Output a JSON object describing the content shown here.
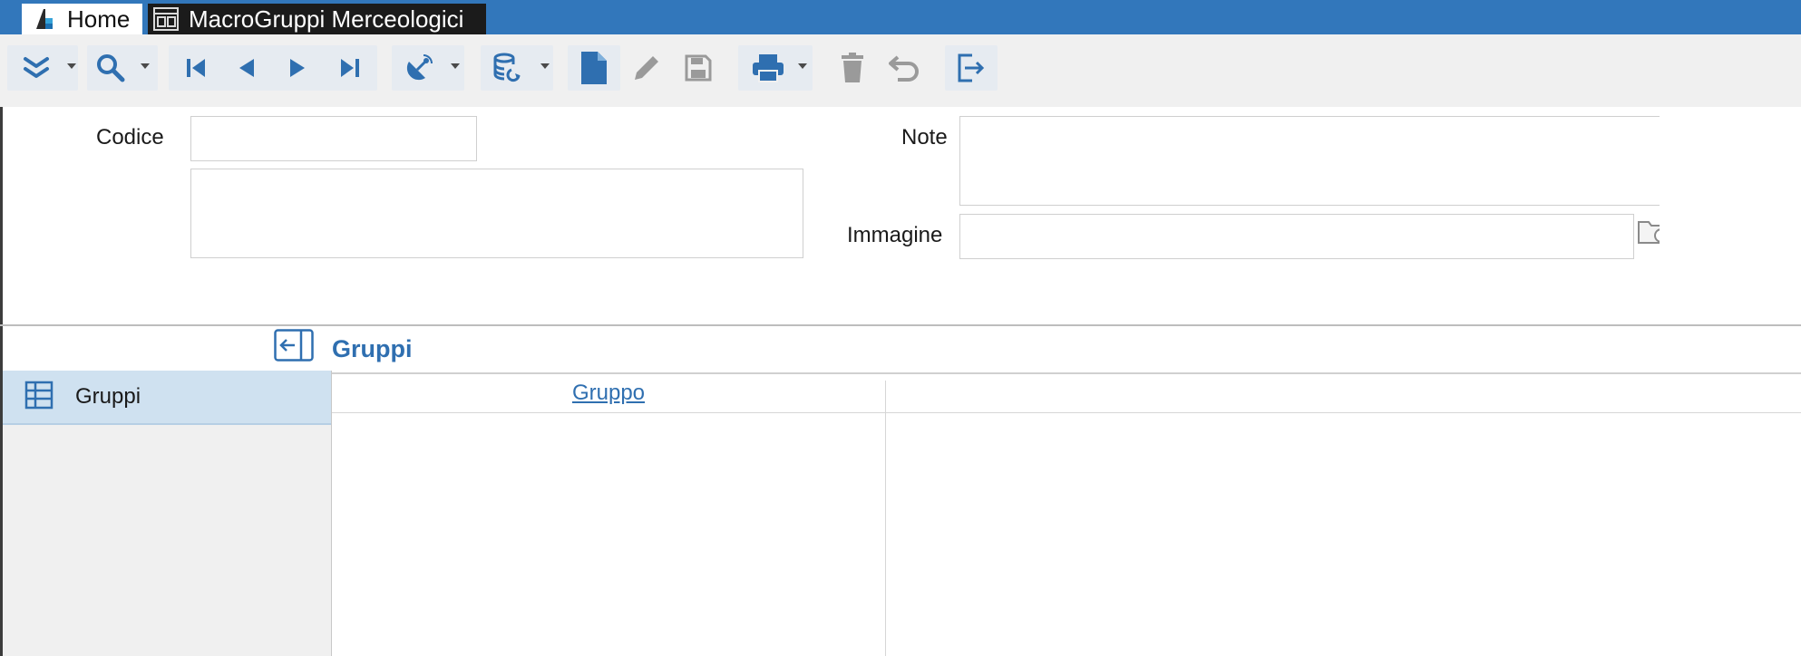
{
  "tabs": {
    "home": "Home",
    "macro": "MacroGruppi Merceologici"
  },
  "toolbar": {
    "icons": [
      "expand-icon",
      "search-icon",
      "first-record-icon",
      "previous-record-icon",
      "next-record-icon",
      "last-record-icon",
      "satellite-icon",
      "database-refresh-icon",
      "new-document-icon",
      "edit-icon",
      "save-icon",
      "print-icon",
      "delete-icon",
      "undo-icon",
      "exit-icon"
    ]
  },
  "form": {
    "codice_label": "Codice",
    "codice_value": "",
    "descrizione_value": "",
    "note_label": "Note",
    "note_value": "",
    "immagine_label": "Immagine",
    "immagine_value": ""
  },
  "section": {
    "title": "Gruppi",
    "nav_items": [
      {
        "label": "Gruppi",
        "icon": "table-icon",
        "selected": true
      }
    ],
    "grid": {
      "columns": [
        "Gruppo"
      ],
      "rows": []
    }
  },
  "colors": {
    "brand": "#3277bb",
    "accent": "#2f6fb0",
    "toolbar_bg": "#f0f0f0",
    "selected_bg": "#cfe1f0"
  }
}
